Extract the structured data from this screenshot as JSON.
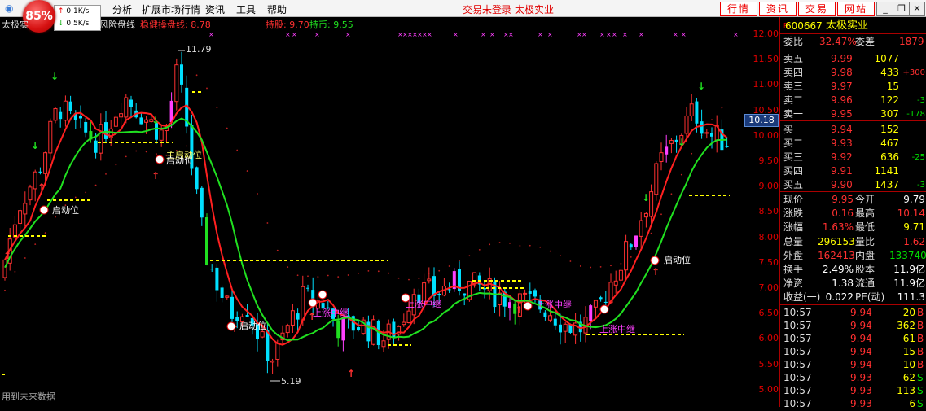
{
  "cpu": {
    "percent": "85%"
  },
  "net": {
    "up": "0.1K/s",
    "down": "0.5K/s"
  },
  "menu": [
    "分析",
    "扩展市场行情",
    "资讯",
    "工具",
    "帮助"
  ],
  "status": {
    "login": "交易未登录",
    "stock_name": "太极实业"
  },
  "buttons": [
    "行情",
    "资讯",
    "交易",
    "网站"
  ],
  "indicator": {
    "title": "太极实",
    "name_suffix": "风险盘线",
    "line1_label": "稳健操盘线: 8.78",
    "line2_label": "持股: 9.70",
    "line3_label": "持币: 9.55"
  },
  "price_axis": [
    "12.00",
    "11.50",
    "11.00",
    "10.50",
    "10.00",
    "9.50",
    "9.00",
    "8.50",
    "8.00",
    "7.50",
    "7.00",
    "6.50",
    "6.00",
    "5.50",
    "5.00"
  ],
  "current_price_tag": "10.18",
  "annotations": {
    "high": "11.79",
    "low": "5.19",
    "start_label": "启动位",
    "start_label2": "主启动位",
    "trend_label": "上涨中继",
    "footer": "用到未来数据"
  },
  "quote": {
    "code": "600667",
    "name": "太极实业",
    "wei_bi_label": "委比",
    "wei_bi": "32.47%",
    "wei_cha_label": "委差",
    "wei_cha": "1879",
    "asks": [
      {
        "label": "卖五",
        "price": "9.99",
        "vol": "1077",
        "chg": ""
      },
      {
        "label": "卖四",
        "price": "9.98",
        "vol": "433",
        "chg": "+300"
      },
      {
        "label": "卖三",
        "price": "9.97",
        "vol": "15",
        "chg": ""
      },
      {
        "label": "卖二",
        "price": "9.96",
        "vol": "122",
        "chg": "-3"
      },
      {
        "label": "卖一",
        "price": "9.95",
        "vol": "307",
        "chg": "-178"
      }
    ],
    "bids": [
      {
        "label": "买一",
        "price": "9.94",
        "vol": "152",
        "chg": ""
      },
      {
        "label": "买二",
        "price": "9.93",
        "vol": "467",
        "chg": ""
      },
      {
        "label": "买三",
        "price": "9.92",
        "vol": "636",
        "chg": "-25"
      },
      {
        "label": "买四",
        "price": "9.91",
        "vol": "1141",
        "chg": ""
      },
      {
        "label": "买五",
        "price": "9.90",
        "vol": "1437",
        "chg": "-3"
      }
    ],
    "stats": [
      {
        "l1": "现价",
        "v1": "9.95",
        "l2": "今开",
        "v2": "9.79",
        "c1": "#ff3030",
        "c2": "#ffffff"
      },
      {
        "l1": "涨跌",
        "v1": "0.16",
        "l2": "最高",
        "v2": "10.14",
        "c1": "#ff3030",
        "c2": "#ff3030"
      },
      {
        "l1": "涨幅",
        "v1": "1.63%",
        "l2": "最低",
        "v2": "9.71",
        "c1": "#ff3030",
        "c2": "#ffff00"
      },
      {
        "l1": "总量",
        "v1": "296153",
        "l2": "量比",
        "v2": "1.62",
        "c1": "#ffff00",
        "c2": "#ff3030"
      },
      {
        "l1": "外盘",
        "v1": "162413",
        "l2": "内盘",
        "v2": "133740",
        "c1": "#ff3030",
        "c2": "#00e000"
      },
      {
        "l1": "换手",
        "v1": "2.49%",
        "l2": "股本",
        "v2": "11.9亿",
        "c1": "#ffffff",
        "c2": "#ffffff"
      },
      {
        "l1": "净资",
        "v1": "1.38",
        "l2": "流通",
        "v2": "11.9亿",
        "c1": "#ffffff",
        "c2": "#ffffff"
      },
      {
        "l1": "收益(一)",
        "v1": "0.022",
        "l2": "PE(动)",
        "v2": "111.3",
        "c1": "#ffffff",
        "c2": "#ffffff"
      }
    ],
    "ticks": [
      {
        "time": "10:57",
        "price": "9.94",
        "vol": "20",
        "dir": "B"
      },
      {
        "time": "10:57",
        "price": "9.94",
        "vol": "362",
        "dir": "B"
      },
      {
        "time": "10:57",
        "price": "9.94",
        "vol": "61",
        "dir": "B"
      },
      {
        "time": "10:57",
        "price": "9.94",
        "vol": "15",
        "dir": "B"
      },
      {
        "time": "10:57",
        "price": "9.94",
        "vol": "10",
        "dir": "B"
      },
      {
        "time": "10:57",
        "price": "9.93",
        "vol": "62",
        "dir": "S"
      },
      {
        "time": "10:57",
        "price": "9.93",
        "vol": "113",
        "dir": "S"
      },
      {
        "time": "10:57",
        "price": "9.93",
        "vol": "6",
        "dir": "S"
      }
    ]
  },
  "colors": {
    "up": "#ff3030",
    "down": "#00e0ff",
    "ma_red": "#ff2020",
    "ma_green": "#20e020",
    "axis": "#a00000"
  }
}
